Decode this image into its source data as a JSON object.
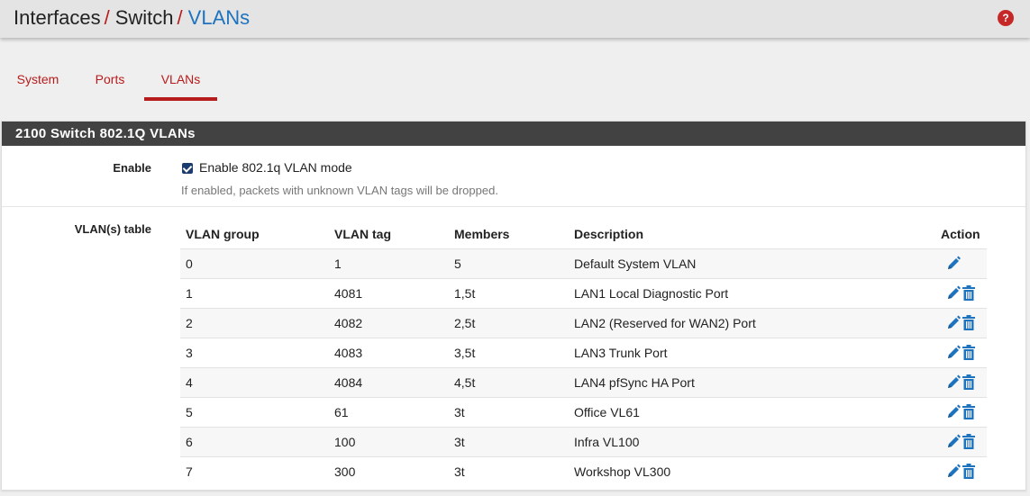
{
  "header": {
    "crumb1": "Interfaces",
    "crumb2": "Switch",
    "crumb3": "VLANs",
    "separator": "/",
    "help": "?"
  },
  "tabs": [
    {
      "label": "System"
    },
    {
      "label": "Ports"
    },
    {
      "label": "VLANs",
      "active": true
    }
  ],
  "panel": {
    "title": "2100 Switch 802.1Q VLANs",
    "enable_label": "Enable",
    "enable_checkbox_text": "Enable 802.1q VLAN mode",
    "enable_checked": true,
    "enable_hint": "If enabled, packets with unknown VLAN tags will be dropped.",
    "table_label": "VLAN(s) table"
  },
  "table": {
    "headers": [
      "VLAN group",
      "VLAN tag",
      "Members",
      "Description",
      "Action"
    ],
    "rows": [
      {
        "group": "0",
        "tag": "1",
        "members": "5",
        "description": "Default System VLAN",
        "deletable": false
      },
      {
        "group": "1",
        "tag": "4081",
        "members": "1,5t",
        "description": "LAN1 Local Diagnostic Port",
        "deletable": true
      },
      {
        "group": "2",
        "tag": "4082",
        "members": "2,5t",
        "description": "LAN2 (Reserved for WAN2) Port",
        "deletable": true
      },
      {
        "group": "3",
        "tag": "4083",
        "members": "3,5t",
        "description": "LAN3 Trunk Port",
        "deletable": true
      },
      {
        "group": "4",
        "tag": "4084",
        "members": "4,5t",
        "description": "LAN4 pfSync HA Port",
        "deletable": true
      },
      {
        "group": "5",
        "tag": "61",
        "members": "3t",
        "description": "Office VL61",
        "deletable": true
      },
      {
        "group": "6",
        "tag": "100",
        "members": "3t",
        "description": "Infra VL100",
        "deletable": true
      },
      {
        "group": "7",
        "tag": "300",
        "members": "3t",
        "description": "Workshop VL300",
        "deletable": true
      }
    ]
  },
  "colors": {
    "accent": "#b71c1c",
    "link": "#1e73be",
    "panel_heading": "#424242"
  },
  "icons": [
    "help-icon",
    "pencil-icon",
    "trash-icon"
  ]
}
